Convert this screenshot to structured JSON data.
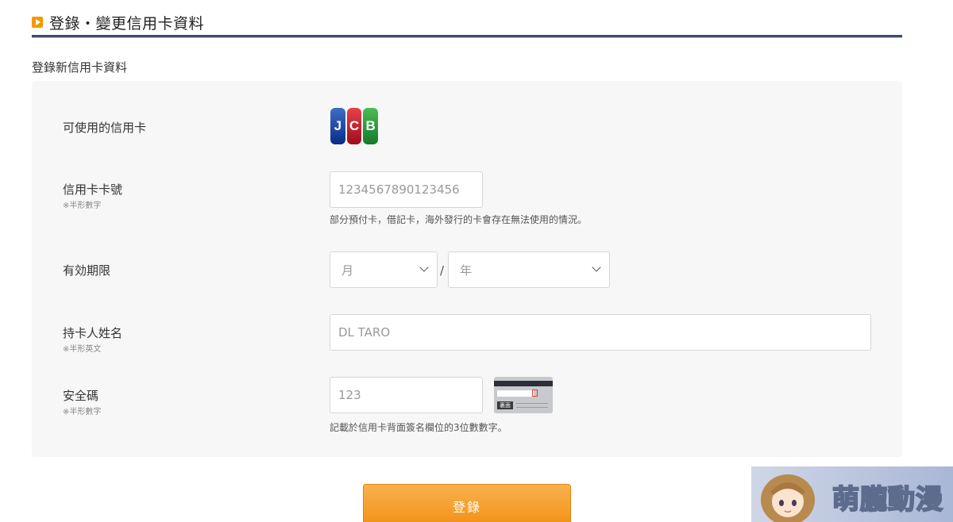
{
  "header": {
    "title": "登錄・變更信用卡資料"
  },
  "section": {
    "title": "登錄新信用卡資料"
  },
  "form": {
    "card_types": {
      "label": "可使用的信用卡",
      "logo": {
        "letters": [
          "J",
          "C",
          "B"
        ]
      }
    },
    "card_number": {
      "label": "信用卡卡號",
      "note": "※半形數字",
      "placeholder": "1234567890123456",
      "helper": "部分預付卡，借記卡，海外發行的卡會存在無法使用的情況。"
    },
    "expiry": {
      "label": "有効期限",
      "month_placeholder": "月",
      "year_placeholder": "年",
      "separator": "/"
    },
    "holder_name": {
      "label": "持卡人姓名",
      "note": "※半形英文",
      "placeholder": "DL TARO"
    },
    "cvv": {
      "label": "安全碼",
      "note": "※半形數字",
      "placeholder": "123",
      "helper": "記載於信用卡背面簽名欄位的3位數數字。",
      "card_tag": "裏面"
    }
  },
  "submit_label": "登錄",
  "watermark": {
    "text": "萌朧動漫"
  },
  "colors": {
    "accent": "#f39a00",
    "header_rule": "#3e4a6e",
    "button": "#f4a02a"
  }
}
